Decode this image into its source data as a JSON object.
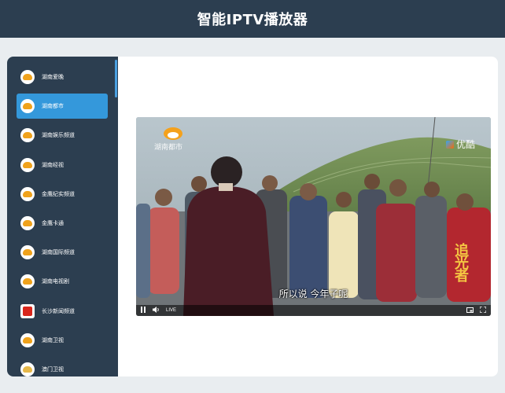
{
  "app": {
    "title": "智能IPTV播放器"
  },
  "channels": [
    {
      "label": "湖南爱晚",
      "active": false,
      "logo": "hunan-tv-logo"
    },
    {
      "label": "湖南都市",
      "active": true,
      "logo": "hunan-tv-logo"
    },
    {
      "label": "湖南娱乐频道",
      "active": false,
      "logo": "hunan-tv-logo"
    },
    {
      "label": "湖南经视",
      "active": false,
      "logo": "hunan-tv-logo"
    },
    {
      "label": "金鹰纪实频道",
      "active": false,
      "logo": "hunan-tv-logo"
    },
    {
      "label": "金鹰卡通",
      "active": false,
      "logo": "hunan-tv-logo"
    },
    {
      "label": "湖南国际频道",
      "active": false,
      "logo": "hunan-tv-logo"
    },
    {
      "label": "湖南电视剧",
      "active": false,
      "logo": "hunan-tv-logo"
    },
    {
      "label": "长沙新闻频道",
      "active": false,
      "logo": "changsha-logo"
    },
    {
      "label": "湖南卫视",
      "active": false,
      "logo": "hunan-tv-logo"
    },
    {
      "label": "澳门卫视",
      "active": false,
      "logo": "macau-logo"
    }
  ],
  "player": {
    "station_watermark": "湖南都市",
    "platform_watermark": "优酷",
    "subtitle": "所以说 今年子呢",
    "program_title": "追光者",
    "live_label": "LIVE",
    "playing": true
  },
  "colors": {
    "header_bg": "#2c3e50",
    "sidebar_bg": "#2c3e50",
    "active_item": "#3498db",
    "page_bg": "#e9edf0"
  }
}
